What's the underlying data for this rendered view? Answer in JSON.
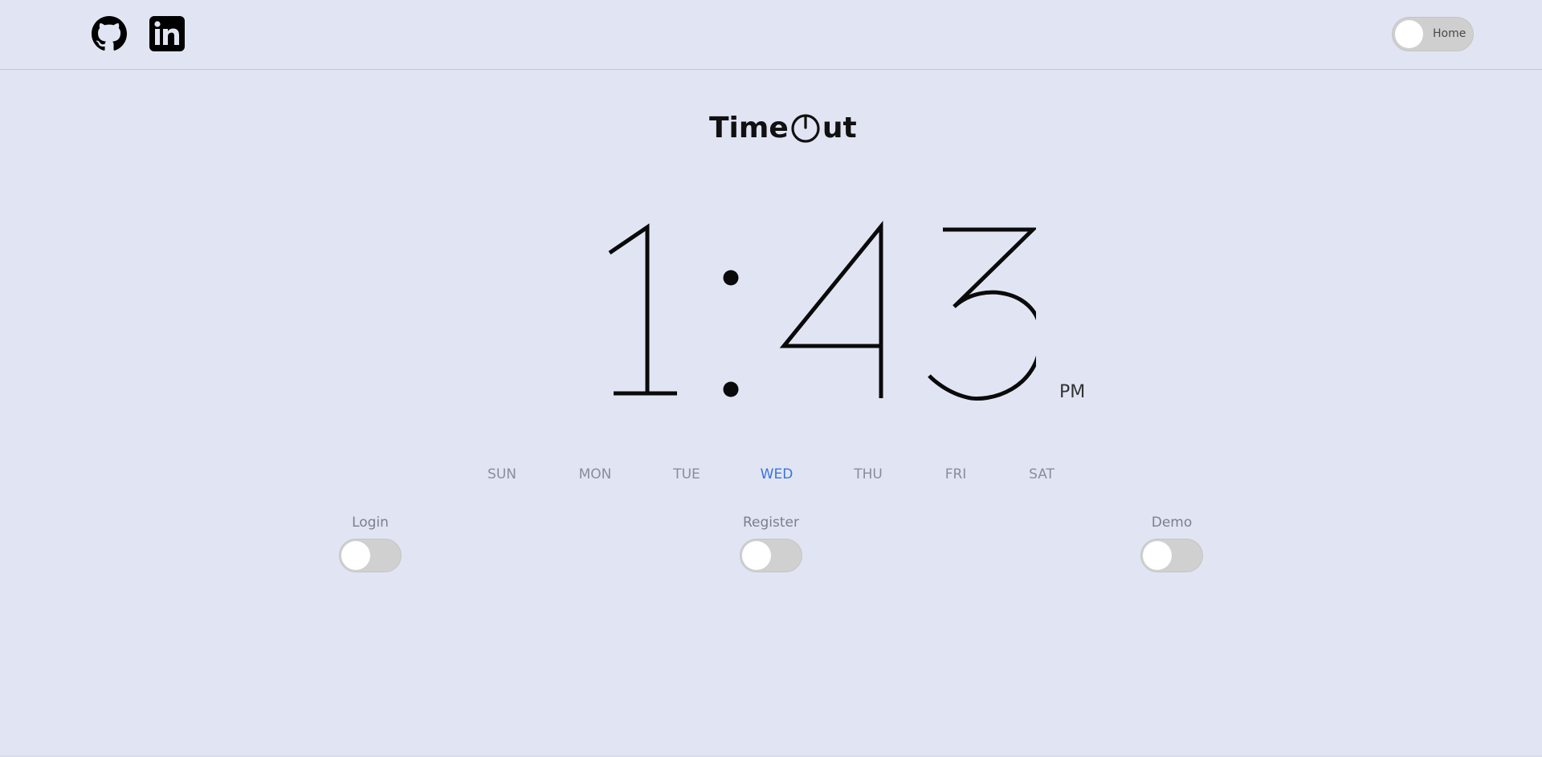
{
  "header": {
    "github_icon": "github-icon",
    "linkedin_icon": "linkedin-icon",
    "home_toggle_label": "Home"
  },
  "logo": {
    "text_before": "Time",
    "text_after": "ut",
    "icon": "power-clock-icon"
  },
  "clock": {
    "hour": "1",
    "minutes": "43",
    "period": "PM"
  },
  "days": {
    "items": [
      "SUN",
      "MON",
      "TUE",
      "WED",
      "THU",
      "FRI",
      "SAT"
    ],
    "active": "WED",
    "active_color": "#3b74d7",
    "inactive_color": "#8a8d98"
  },
  "toggles": {
    "login": {
      "label": "Login"
    },
    "register": {
      "label": "Register"
    },
    "demo": {
      "label": "Demo"
    }
  },
  "colors": {
    "background": "#e1e5f3",
    "toggle_track": "#d0d0d0"
  }
}
